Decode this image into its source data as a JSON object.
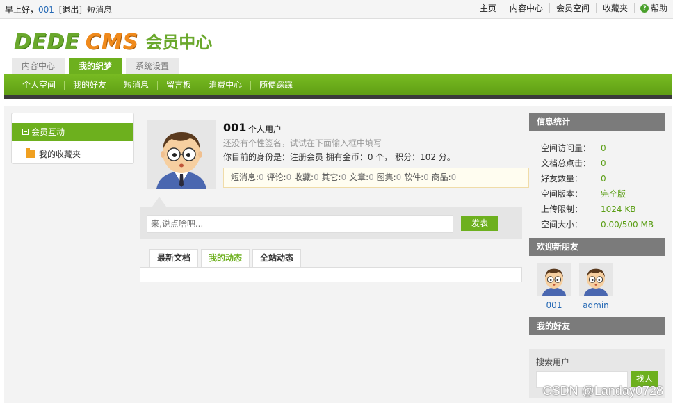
{
  "topbar": {
    "greeting": "早上好，",
    "user": "001",
    "logout": "[退出]",
    "messages": "短消息",
    "links": [
      "主页",
      "内容中心",
      "会员空间",
      "收藏夹"
    ],
    "help": "帮助"
  },
  "logo": {
    "dede": "DEDE",
    "cms": "CMS",
    "center": "会员中心"
  },
  "main_tabs": [
    {
      "label": "内容中心",
      "active": false
    },
    {
      "label": "我的织梦",
      "active": true
    },
    {
      "label": "系统设置",
      "active": false
    }
  ],
  "nav": [
    "个人空间",
    "我的好友",
    "短消息",
    "留言板",
    "消费中心",
    "随便踩踩"
  ],
  "left_menu": {
    "group": "会员互动",
    "item": "我的收藏夹"
  },
  "profile": {
    "name": "001",
    "type": "个人用户",
    "signature_hint": "还没有个性签名，试试在下面输入框中填写",
    "info": "你目前的身份是：注册会员 拥有金币：0 个， 积分：102 分。",
    "counts": [
      {
        "label": "短消息:",
        "value": "0"
      },
      {
        "label": "评论:",
        "value": "0"
      },
      {
        "label": "收藏:",
        "value": "0"
      },
      {
        "label": "其它:",
        "value": "0"
      },
      {
        "label": "文章:",
        "value": "0"
      },
      {
        "label": "图集:",
        "value": "0"
      },
      {
        "label": "软件:",
        "value": "0"
      },
      {
        "label": "商品:",
        "value": "0"
      }
    ]
  },
  "post": {
    "placeholder": "来,说点啥吧...",
    "button": "发表"
  },
  "feed_tabs": [
    {
      "label": "最新文档",
      "active": false
    },
    {
      "label": "我的动态",
      "active": true
    },
    {
      "label": "全站动态",
      "active": false
    }
  ],
  "stats": {
    "title": "信息统计",
    "rows": [
      {
        "key": "空间访问量：",
        "value": "0"
      },
      {
        "key": "文档总点击：",
        "value": "0"
      },
      {
        "key": "好友数量：",
        "value": "0"
      },
      {
        "key": "空间版本：",
        "value": "完全版"
      },
      {
        "key": "上传限制：",
        "value": "1024 KB"
      },
      {
        "key": "空间大小：",
        "value": "0.00/500 MB"
      }
    ]
  },
  "new_friends": {
    "title": "欢迎新朋友",
    "users": [
      "001",
      "admin"
    ]
  },
  "my_friends": {
    "title": "我的好友"
  },
  "search": {
    "label": "搜索用户",
    "button": "找人"
  },
  "watermark": "CSDN @Landay0728"
}
